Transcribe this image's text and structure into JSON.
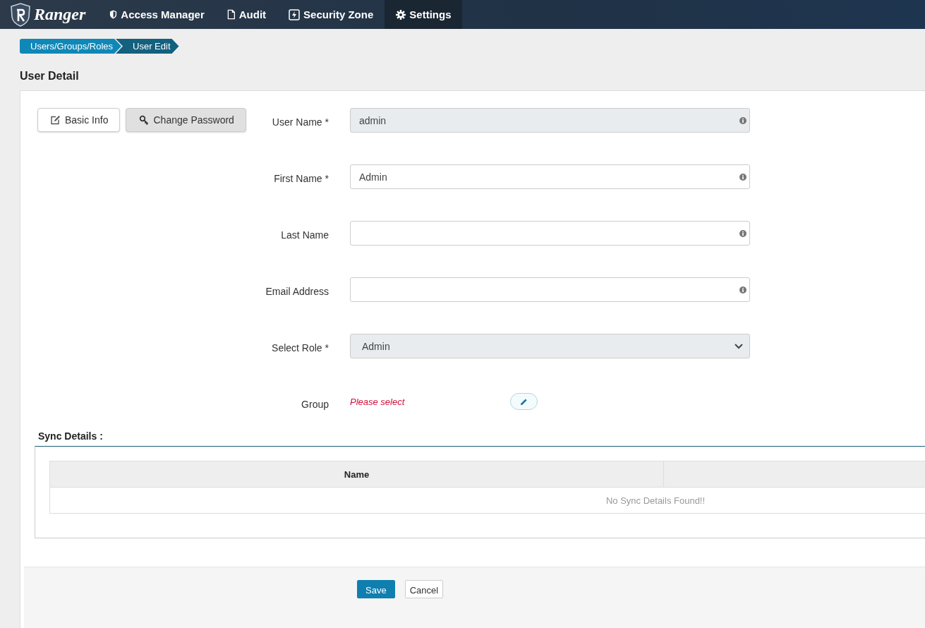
{
  "navbar": {
    "brand": "Ranger",
    "items": [
      {
        "label": "Access Manager",
        "selected": false
      },
      {
        "label": "Audit",
        "selected": false
      },
      {
        "label": "Security Zone",
        "selected": false
      },
      {
        "label": "Settings",
        "selected": true
      }
    ]
  },
  "breadcrumb": [
    {
      "label": "Users/Groups/Roles",
      "selected": false
    },
    {
      "label": "User Edit",
      "selected": true
    }
  ],
  "page_title": "User Detail",
  "tabs": [
    {
      "label": "Basic Info",
      "selected": true
    },
    {
      "label": "Change Password",
      "selected": false
    }
  ],
  "fields": [
    {
      "kind": "text",
      "label": "User Name *",
      "value": "admin",
      "disabled": true
    },
    {
      "kind": "text",
      "label": "First Name *",
      "value": "Admin",
      "disabled": false
    },
    {
      "kind": "text",
      "label": "Last Name",
      "disabled": false
    },
    {
      "kind": "text",
      "label": "Email Address",
      "disabled": false
    },
    {
      "kind": "select",
      "label": "Select Role *",
      "value": "Admin",
      "disabled": true
    },
    {
      "kind": "group",
      "label": "Group",
      "placeholder": "Please select"
    }
  ],
  "sync_details": {
    "title": "Sync Details :",
    "columns": [
      "Name"
    ],
    "empty_message": "No Sync Details Found!!"
  },
  "buttons": [
    {
      "label": "Save",
      "kind": "primary"
    },
    {
      "label": "Cancel",
      "kind": "default"
    }
  ]
}
